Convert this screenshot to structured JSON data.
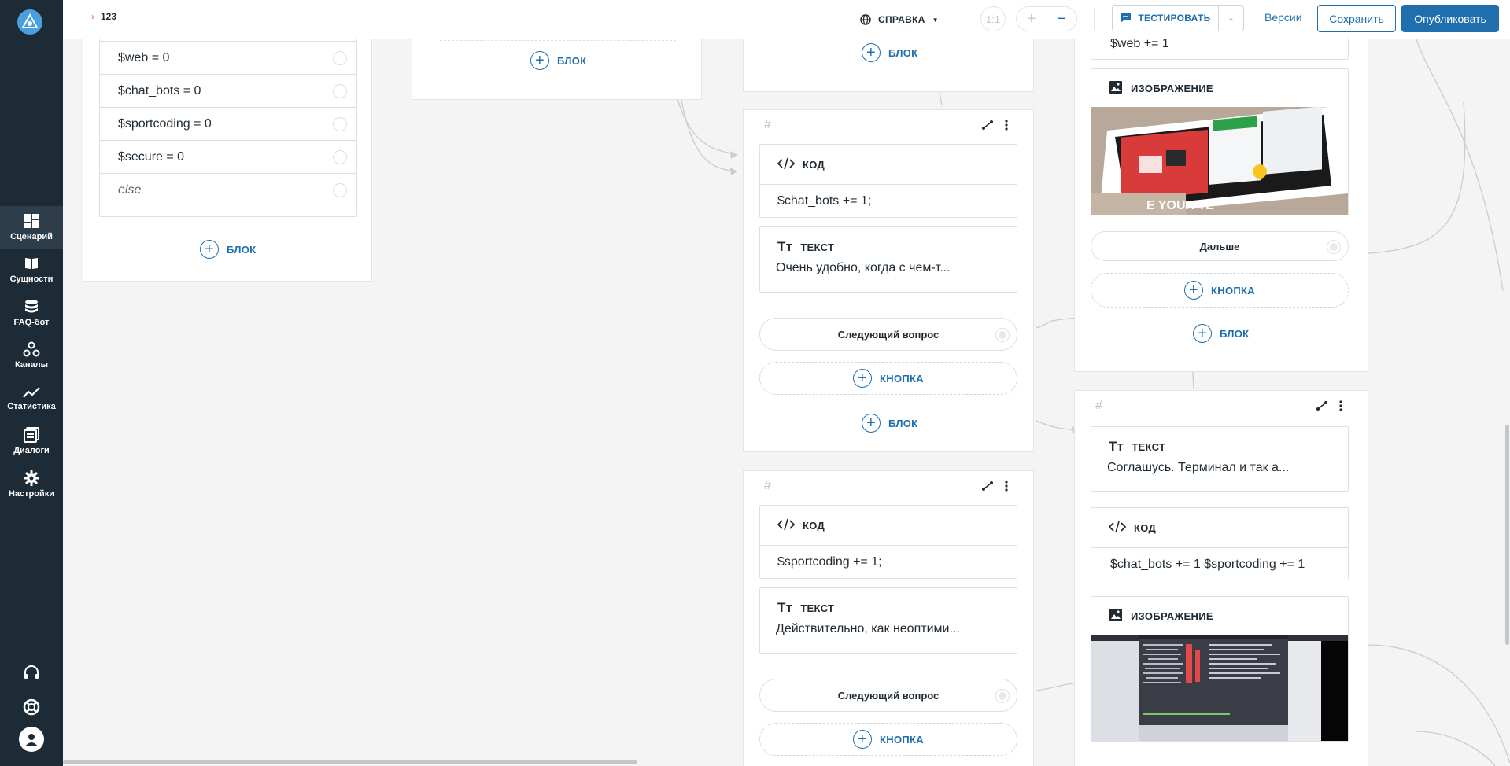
{
  "sidebar": {
    "items": [
      {
        "label": "Сценарий",
        "icon": "dashboard-icon",
        "active": true
      },
      {
        "label": "Сущности",
        "icon": "book-icon",
        "active": false
      },
      {
        "label": "FAQ-бот",
        "icon": "database-icon",
        "active": false
      },
      {
        "label": "Каналы",
        "icon": "channels-icon",
        "active": false
      },
      {
        "label": "Статистика",
        "icon": "chart-line-icon",
        "active": false
      },
      {
        "label": "Диалоги",
        "icon": "dialogs-icon",
        "active": false
      },
      {
        "label": "Настройки",
        "icon": "gear-icon",
        "active": false
      }
    ],
    "bottom_icons": [
      "headset-icon",
      "lifebuoy-icon",
      "user-avatar-icon"
    ]
  },
  "header": {
    "breadcrumb": "123",
    "help_label": "СПРАВКА",
    "zoom_reset_label": "1:1",
    "zoom_in_label": "+",
    "zoom_out_label": "−",
    "test_label": "ТЕСТИРОВАТЬ",
    "versions_label": "Версии",
    "save_label": "Сохранить",
    "publish_label": "Опубликовать"
  },
  "canvas": {
    "conditions_card": {
      "rows": [
        "$web = 0",
        "$chat_bots = 0",
        "$sportcoding = 0",
        "$secure = 0",
        "else"
      ],
      "add_block_label": "БЛОК"
    },
    "top_middle_card": {
      "add_block_label": "БЛОК"
    },
    "top_right_middle_card": {
      "add_block_label": "БЛОК"
    },
    "card_a": {
      "code_title": "КОД",
      "code_value": "$chat_bots += 1;",
      "text_title": "ТЕКСТ",
      "text_value": "Очень удобно, когда с чем-т...",
      "button_label": "Следующий вопрос",
      "add_button_label": "КНОПКА",
      "add_block_label": "БЛОК"
    },
    "card_b": {
      "code_title": "КОД",
      "code_value": "$sportcoding += 1;",
      "text_title": "ТЕКСТ",
      "text_value": "Действительно, как неоптими...",
      "button_label": "Следующий вопрос",
      "add_button_label": "КНОПКА"
    },
    "card_c": {
      "partial_code": "$web += 1",
      "image_title": "ИЗОБРАЖЕНИЕ",
      "button_label": "Дальше",
      "add_button_label": "КНОПКА",
      "add_block_label": "БЛОК"
    },
    "card_d": {
      "text_title": "ТЕКСТ",
      "text_value": "Соглашусь. Терминал и так а...",
      "code_title": "КОД",
      "code_value": "$chat_bots += 1 $sportcoding += 1",
      "image_title": "ИЗОБРАЖЕНИЕ"
    },
    "hash_symbol": "#"
  },
  "colors": {
    "sidebar_bg": "#1d2b36",
    "accent": "#1f6fae",
    "canvas_bg": "#f3f4f3"
  }
}
